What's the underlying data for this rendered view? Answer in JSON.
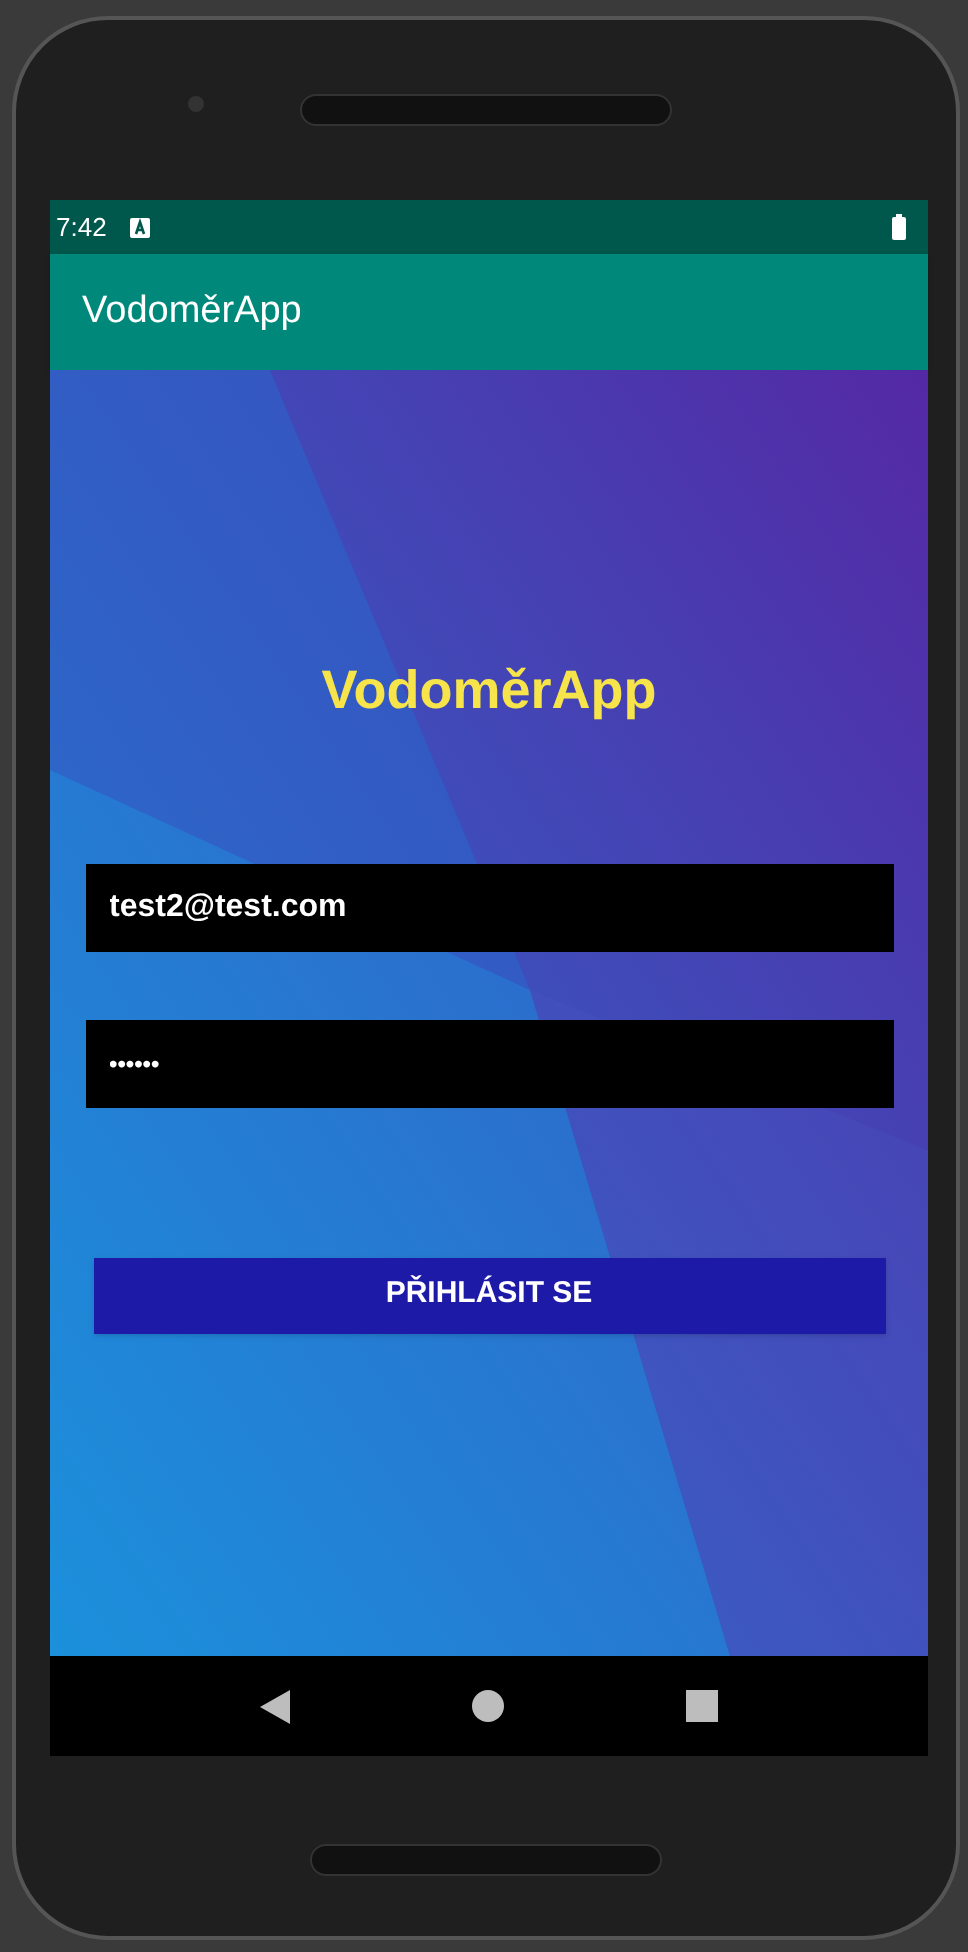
{
  "status_bar": {
    "time": "7:42"
  },
  "app_bar": {
    "title": "VodoměrApp"
  },
  "login": {
    "logo_text": "VodoměrApp",
    "email": {
      "value": "test2@test.com"
    },
    "password": {
      "value": "••••••"
    },
    "submit_button": "PŘIHLÁSIT SE"
  }
}
